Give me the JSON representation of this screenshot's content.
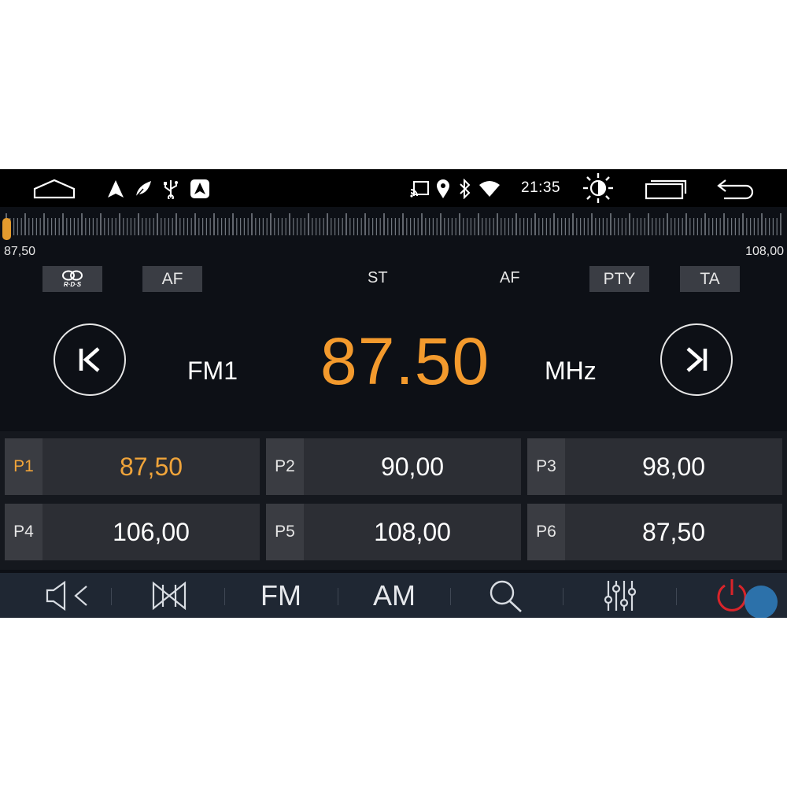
{
  "status_bar": {
    "time": "21:35",
    "icons": [
      "home-icon",
      "navigation-arrow-icon",
      "leaf-icon",
      "usb-icon",
      "carplay-icon",
      "cast-icon",
      "location-pin-icon",
      "bluetooth-icon",
      "wifi-icon",
      "brightness-icon",
      "recent-apps-icon",
      "back-icon"
    ]
  },
  "tuner": {
    "min_label": "87,50",
    "max_label": "108,00",
    "position_fraction": 0.0,
    "handle_color": "#e39a2e"
  },
  "rds": {
    "rds_logo": "R·D·S",
    "af_button": "AF",
    "st_indicator": "ST",
    "af_indicator": "AF",
    "pty_button": "PTY",
    "ta_button": "TA"
  },
  "main": {
    "band": "FM1",
    "frequency": "87.50",
    "unit": "MHz",
    "frequency_color": "#f39a2d"
  },
  "presets": [
    {
      "num": "P1",
      "freq": "87,50",
      "active": true
    },
    {
      "num": "P2",
      "freq": "90,00",
      "active": false
    },
    {
      "num": "P3",
      "freq": "98,00",
      "active": false
    },
    {
      "num": "P4",
      "freq": "106,00",
      "active": false
    },
    {
      "num": "P5",
      "freq": "108,00",
      "active": false
    },
    {
      "num": "P6",
      "freq": "87,50",
      "active": false
    }
  ],
  "bottom_bar": {
    "fm_label": "FM",
    "am_label": "AM",
    "icons": [
      "volume-icon",
      "loudness-icon",
      "search-icon",
      "equalizer-icon",
      "power-icon"
    ]
  },
  "colors": {
    "accent": "#f39a2d",
    "power_red": "#d9242a",
    "background": "#0d1016"
  }
}
